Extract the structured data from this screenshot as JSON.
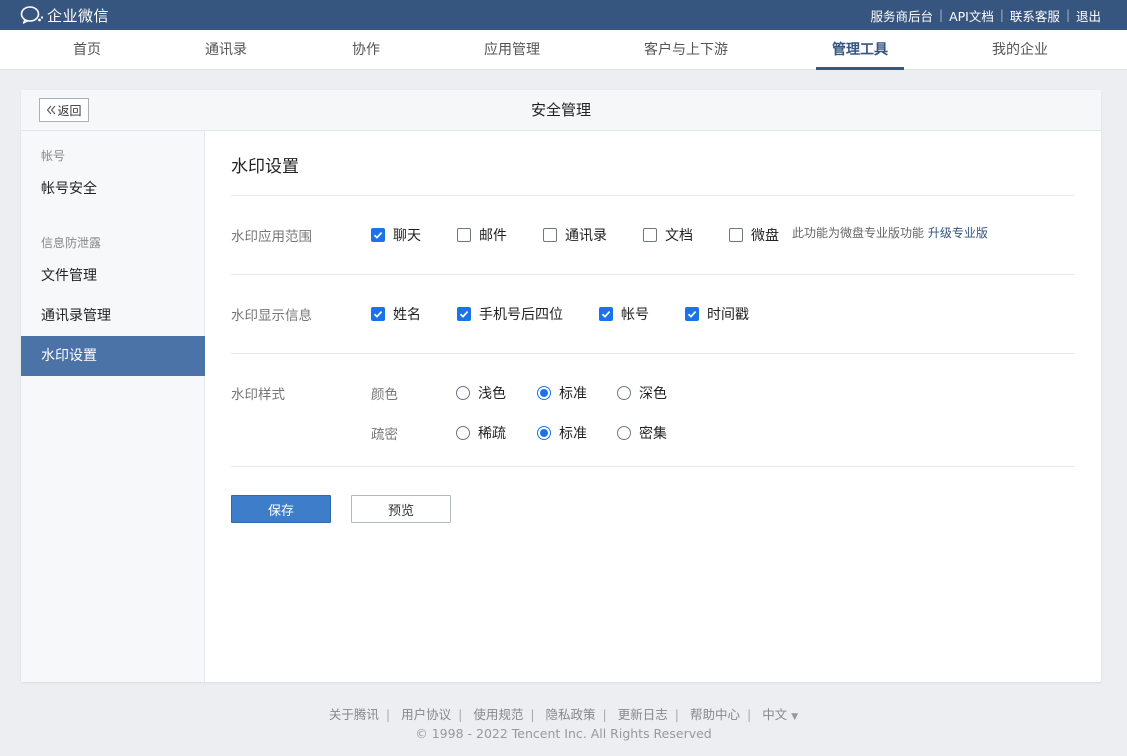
{
  "app": {
    "name": "企业微信"
  },
  "top_links": [
    "服务商后台",
    "API文档",
    "联系客服",
    "退出"
  ],
  "nav": [
    {
      "label": "首页",
      "active": false
    },
    {
      "label": "通讯录",
      "active": false
    },
    {
      "label": "协作",
      "active": false
    },
    {
      "label": "应用管理",
      "active": false
    },
    {
      "label": "客户与上下游",
      "active": false
    },
    {
      "label": "管理工具",
      "active": true
    },
    {
      "label": "我的企业",
      "active": false
    }
  ],
  "card": {
    "back_label": "返回",
    "title": "安全管理"
  },
  "sidebar": {
    "groups": [
      {
        "title": "帐号",
        "items": [
          {
            "label": "帐号安全",
            "active": false
          }
        ]
      },
      {
        "title": "信息防泄露",
        "items": [
          {
            "label": "文件管理",
            "active": false
          },
          {
            "label": "通讯录管理",
            "active": false
          },
          {
            "label": "水印设置",
            "active": true
          }
        ]
      }
    ]
  },
  "main": {
    "title": "水印设置",
    "scope": {
      "label": "水印应用范围",
      "options": [
        {
          "label": "聊天",
          "checked": true
        },
        {
          "label": "邮件",
          "checked": false
        },
        {
          "label": "通讯录",
          "checked": false
        },
        {
          "label": "文档",
          "checked": false
        },
        {
          "label": "微盘",
          "checked": false
        }
      ],
      "note": "此功能为微盘专业版功能",
      "upgrade": "升级专业版"
    },
    "display": {
      "label": "水印显示信息",
      "options": [
        {
          "label": "姓名",
          "checked": true
        },
        {
          "label": "手机号后四位",
          "checked": true
        },
        {
          "label": "帐号",
          "checked": true
        },
        {
          "label": "时间戳",
          "checked": true
        }
      ]
    },
    "style": {
      "label": "水印样式",
      "color": {
        "label": "颜色",
        "options": [
          "浅色",
          "标准",
          "深色"
        ],
        "selected": "标准"
      },
      "density": {
        "label": "疏密",
        "options": [
          "稀疏",
          "标准",
          "密集"
        ],
        "selected": "标准"
      }
    },
    "save_label": "保存",
    "preview_label": "预览"
  },
  "footer": {
    "links": [
      "关于腾讯",
      "用户协议",
      "使用规范",
      "隐私政策",
      "更新日志",
      "帮助中心",
      "中文"
    ],
    "copyright": "© 1998 - 2022 Tencent Inc. All Rights Reserved"
  },
  "colors": {
    "brand": "#36557f",
    "accent": "#1a73e8",
    "sidebar_active": "#4b73a8",
    "save_button": "#3d7dca"
  }
}
